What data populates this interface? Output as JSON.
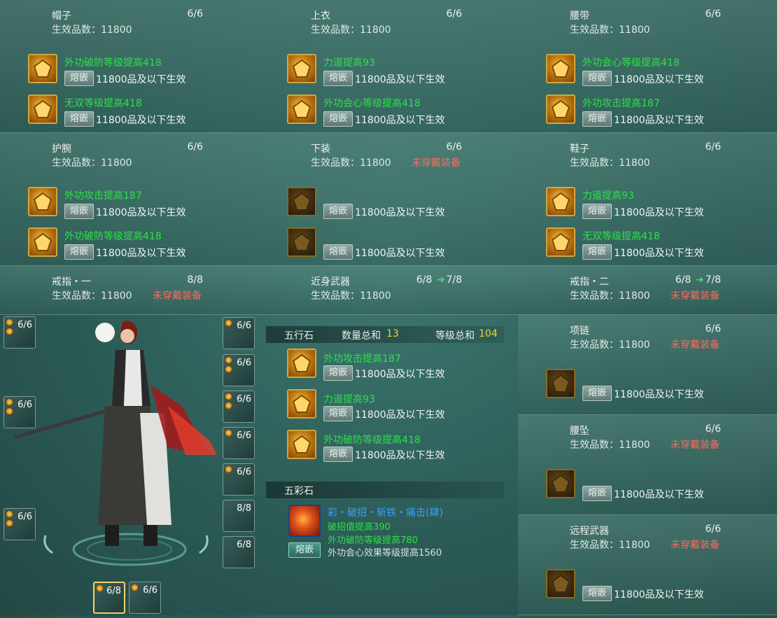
{
  "labels": {
    "level_prefix": "生效品数：11800",
    "rongqian": "熔嵌",
    "effect": "11800品及以下生效",
    "not_equipped": "未穿戴装备"
  },
  "equipment": [
    {
      "name": "帽子",
      "count": "6/6",
      "gems": [
        "外功破防等级提高418",
        "无双等级提高418"
      ]
    },
    {
      "name": "上衣",
      "count": "6/6",
      "gems": [
        "力道提高93",
        "外功会心等级提高418"
      ]
    },
    {
      "name": "腰带",
      "count": "6/6",
      "gems": [
        "外功会心等级提高418",
        "外功攻击提高187"
      ]
    },
    {
      "name": "护腕",
      "count": "6/6",
      "gems": [
        "外功攻击提高187",
        "外功破防等级提高418"
      ]
    },
    {
      "name": "下装",
      "count": "6/6",
      "status": "未穿戴装备"
    },
    {
      "name": "鞋子",
      "count": "6/6",
      "gems": [
        "力道提高93",
        "无双等级提高418"
      ]
    },
    {
      "name": "戒指・一",
      "count": "8/8",
      "status": "未穿戴装备"
    },
    {
      "name": "近身武器",
      "count_from": "6/8",
      "count_to": "7/8"
    },
    {
      "name": "戒指・二",
      "count_from": "6/8",
      "count_to": "7/8",
      "status": "未穿戴装备"
    },
    {
      "name": "项链",
      "count": "6/6",
      "status": "未穿戴装备"
    },
    {
      "name": "腰坠",
      "count": "6/6",
      "status": "未穿戴装备"
    },
    {
      "name": "远程武器",
      "count": "6/6",
      "status": "未穿戴装备"
    }
  ],
  "wuxing": {
    "title": "五行石",
    "qty_label": "数量总和",
    "qty": "13",
    "level_label": "等级总和",
    "level": "104",
    "gems": [
      "外功攻击提高187",
      "力道提高93",
      "外功破防等级提高418"
    ]
  },
  "wucai": {
    "title": "五彩石",
    "name": "彩・破招・斩铁・痛击(肆)",
    "effects": [
      "破招值提高390",
      "外功破防等级提高780",
      "外功会心效果等级提高1560"
    ]
  },
  "slots": {
    "left": [
      "6/6",
      "6/6",
      "6/6"
    ],
    "right": [
      "6/6",
      "6/6",
      "6/6",
      "6/6",
      "6/6",
      "8/8",
      "6/8"
    ],
    "bottom": [
      "6/8",
      "6/6"
    ]
  },
  "colors": {
    "gem_green": "#2ee04a",
    "warning": "#ff6a5a",
    "highlight": "#f0d23a",
    "name_blue": "#3aa0ff"
  }
}
